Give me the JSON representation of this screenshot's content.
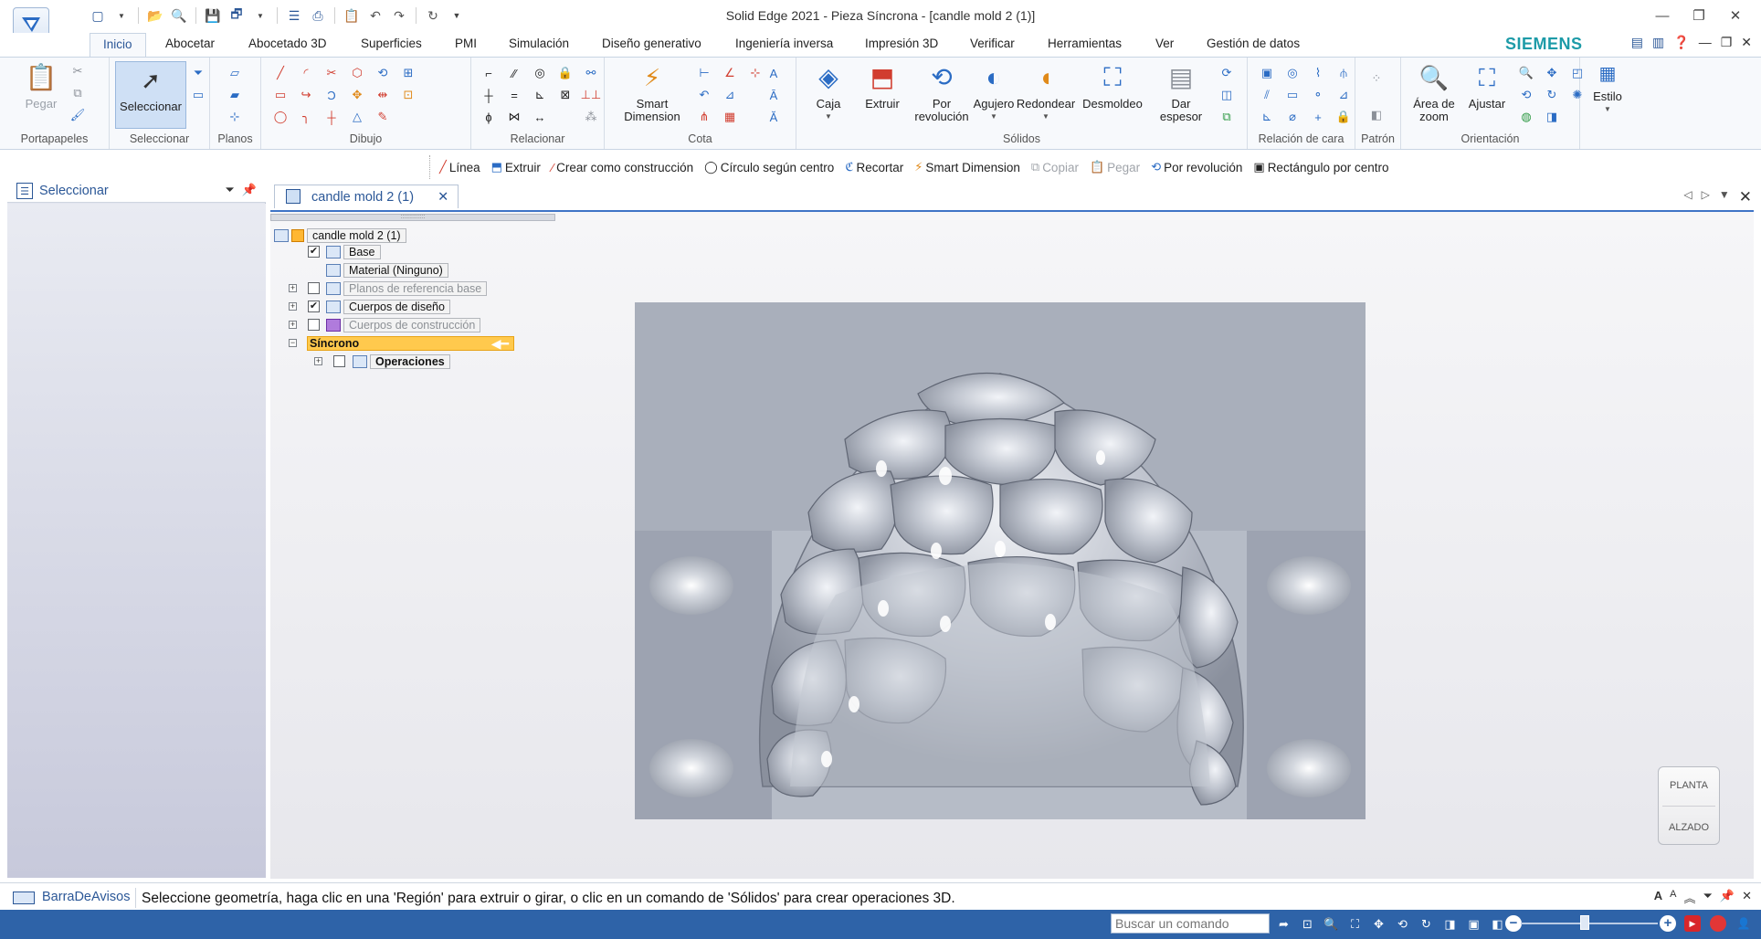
{
  "window": {
    "title": "Solid Edge 2021 - Pieza Síncrona - [candle mold 2 (1)]"
  },
  "tabs": [
    "Inicio",
    "Abocetar",
    "Abocetado 3D",
    "Superficies",
    "PMI",
    "Simulación",
    "Diseño generativo",
    "Ingeniería inversa",
    "Impresión 3D",
    "Verificar",
    "Herramientas",
    "Ver",
    "Gestión de datos"
  ],
  "brand": "SIEMENS",
  "ribbon": {
    "portapapeles": {
      "label": "Portapapeles",
      "paste": "Pegar"
    },
    "seleccionar": {
      "label": "Seleccionar",
      "select": "Seleccionar"
    },
    "planos": {
      "label": "Planos"
    },
    "dibujo": {
      "label": "Dibujo"
    },
    "relacionar": {
      "label": "Relacionar"
    },
    "cota": {
      "label": "Cota",
      "smart_dimension": "Smart Dimension"
    },
    "solidos": {
      "label": "Sólidos",
      "caja": "Caja",
      "extruir": "Extruir",
      "por_revolucion": "Por revolución",
      "agujero": "Agujero",
      "redondear": "Redondear",
      "desmoldeo": "Desmoldeo",
      "dar_espesor": "Dar espesor"
    },
    "relacion_cara": {
      "label": "Relación de cara"
    },
    "patron": {
      "label": "Patrón"
    },
    "orientacion": {
      "label": "Orientación",
      "area_zoom": "Área de zoom",
      "ajustar": "Ajustar"
    },
    "estilo": {
      "label": "Estilo"
    }
  },
  "command_bar": {
    "linea": "Línea",
    "extruir": "Extruir",
    "construccion": "Crear como construcción",
    "circulo": "Círculo según centro",
    "recortar": "Recortar",
    "smart_dimension": "Smart Dimension",
    "copiar": "Copiar",
    "pegar": "Pegar",
    "por_revolucion": "Por revolución",
    "rectangulo": "Rectángulo por centro"
  },
  "left_pane": {
    "title": "Seleccionar"
  },
  "document": {
    "tab": "candle mold 2 (1)"
  },
  "tree": {
    "root": "candle mold 2 (1)",
    "base": "Base",
    "material": "Material (Ninguno)",
    "planos": "Planos de referencia base",
    "cuerpos_diseno": "Cuerpos de diseño",
    "cuerpos_construccion": "Cuerpos de construcción",
    "sincrono": "Síncrono",
    "operaciones": "Operaciones"
  },
  "viewcube": {
    "top": "PLANTA",
    "bottom": "ALZADO"
  },
  "prompt": {
    "title": "BarraDeAvisos",
    "text": "Seleccione geometría, haga clic en una 'Región' para extruir o girar, o clic en un comando de 'Sólidos' para crear operaciones 3D."
  },
  "status": {
    "search_placeholder": "Buscar un comando"
  }
}
